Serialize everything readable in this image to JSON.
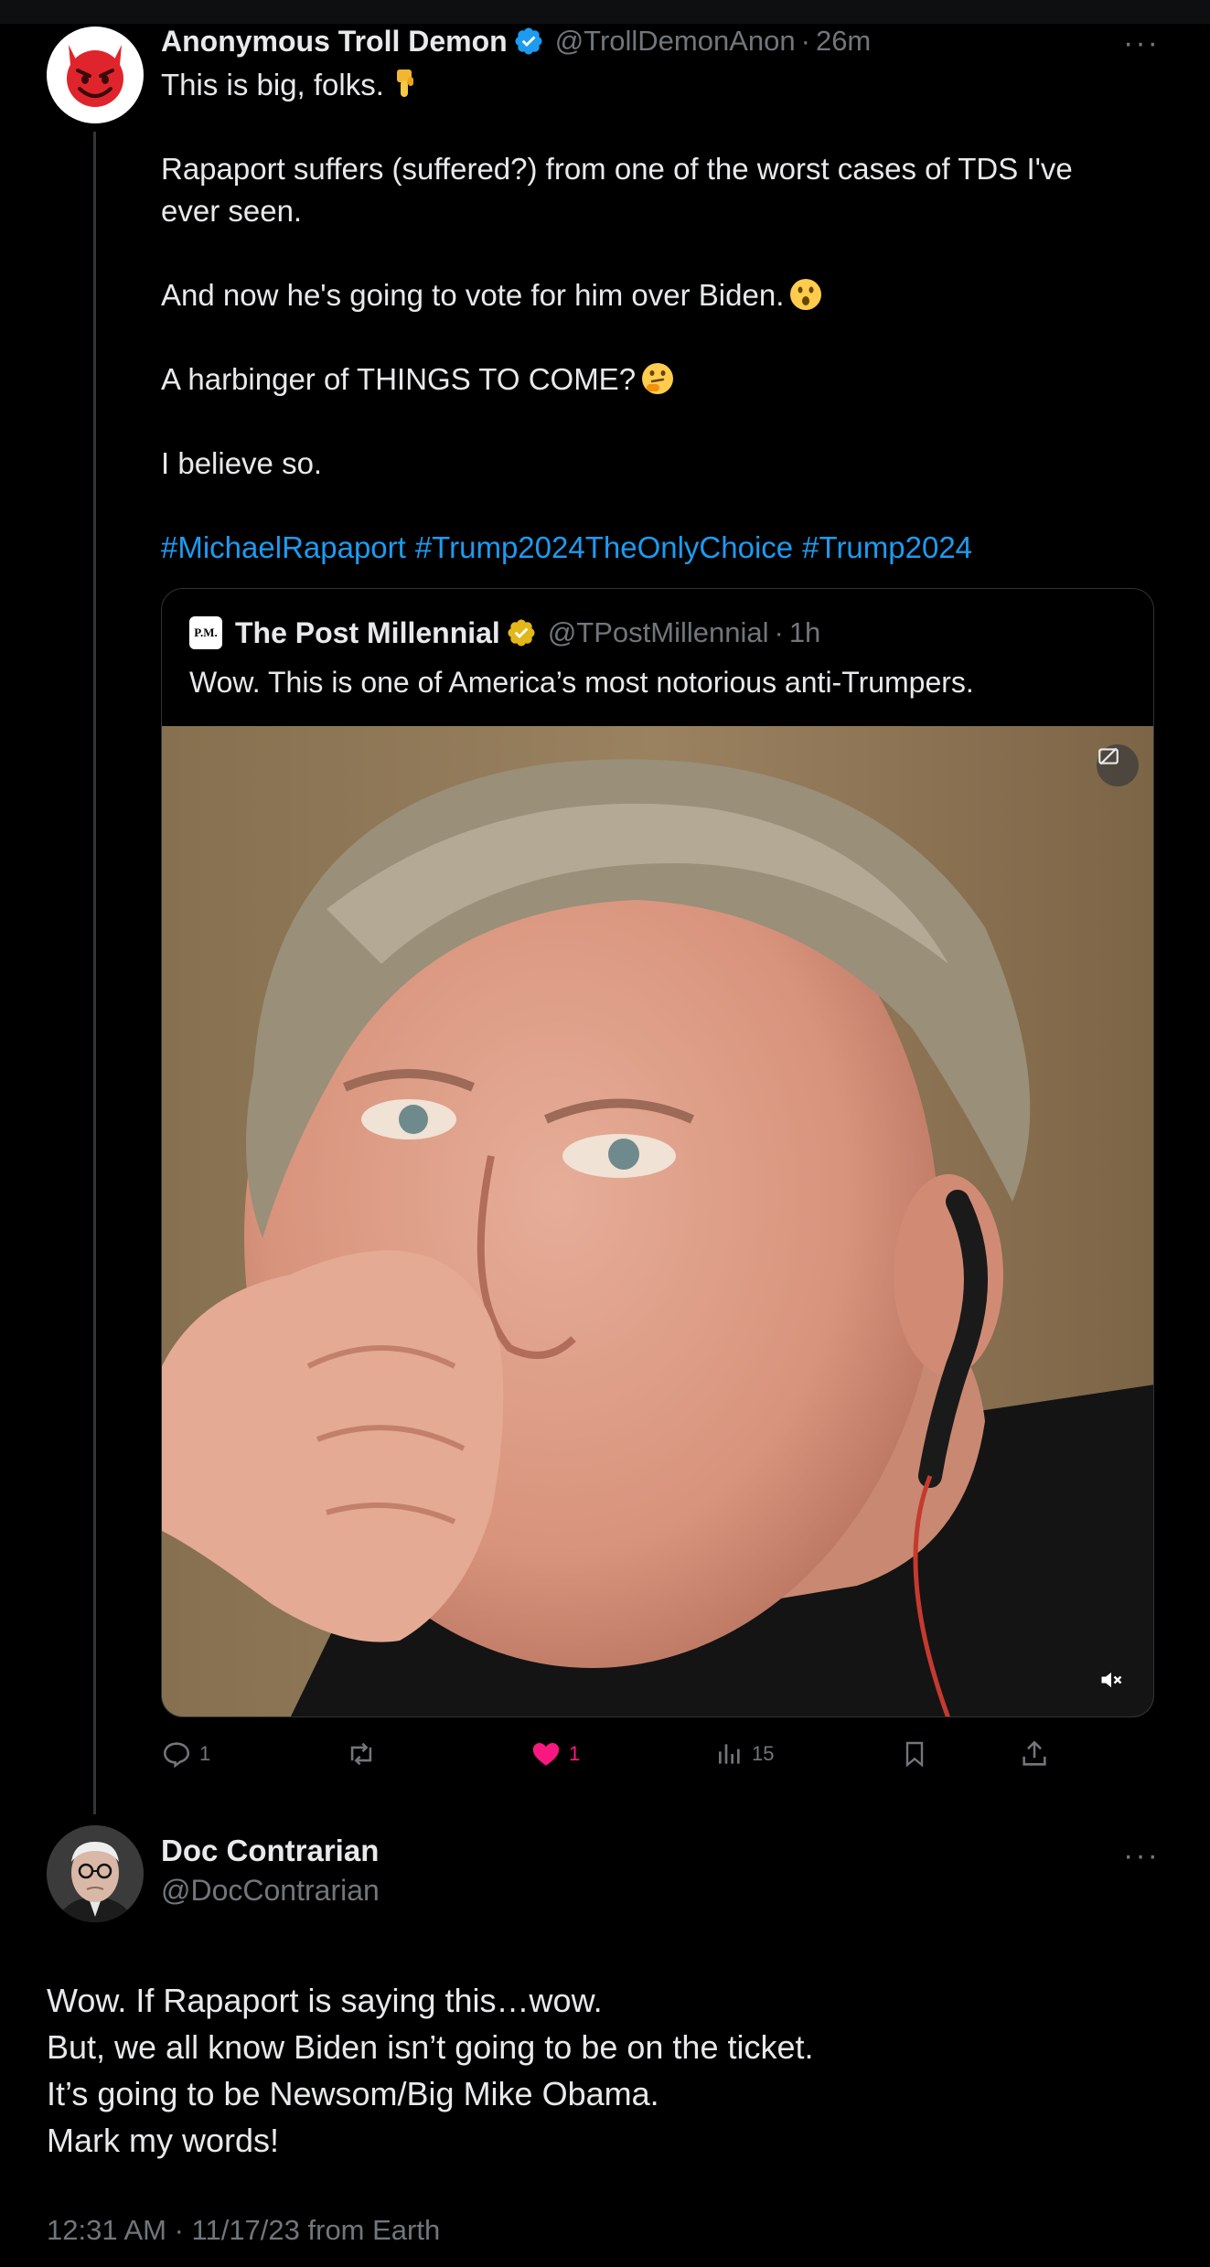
{
  "tweet": {
    "author_name": "Anonymous Troll Demon",
    "author_handle": "@TrollDemonAnon",
    "separator": "·",
    "time_ago": "26m",
    "more_label": "···",
    "avatar_icon": "smiling-devil-icon",
    "lines": [
      {
        "text": "This is big, folks.",
        "emoji": "pointing-down-icon"
      },
      {
        "text": "Rapaport suffers (suffered?) from one of the worst cases of TDS I've ever seen.",
        "emoji": ""
      },
      {
        "text": "And now he's going to vote for him over Biden.",
        "emoji": "astonished-face-icon"
      },
      {
        "text": "A harbinger of THINGS TO COME?",
        "emoji": "thinking-face-icon"
      },
      {
        "text": "I believe so.",
        "emoji": ""
      }
    ],
    "hashtags": [
      "#MichaelRapaport",
      "#Trump2024TheOnlyChoice",
      "#Trump2024"
    ],
    "quote": {
      "logo_text": "P.M.",
      "author_name": "The Post Millennial",
      "author_handle": "@TPostMillennial",
      "separator": "·",
      "time_ago": "1h",
      "text": "Wow. This is one of America’s most notorious anti-Trumpers.",
      "media_icon": "video-thumbnail-image",
      "badge_icon": "sensitive-content-icon",
      "mute_icon": "speaker-muted-icon"
    },
    "actions": {
      "replies": "1",
      "retweets": "",
      "likes": "1",
      "views": "15",
      "liked_color": "#f91880"
    }
  },
  "reply": {
    "author_name": "Doc Contrarian",
    "author_handle": "@DocContrarian",
    "more_label": "···",
    "avatar_icon": "elderly-man-portrait",
    "lines": [
      "Wow. If Rapaport is saying this…wow.",
      "But, we all know Biden isn’t going to be on the ticket.",
      "It’s going to be Newsom/Big Mike Obama.",
      "Mark my words!"
    ],
    "timestamp": "12:31 AM · 11/17/23 from Earth"
  },
  "colors": {
    "background": "#000000",
    "text": "#e7e9ea",
    "muted": "#71767b",
    "link": "#1d9bf0",
    "verified_blue": "#1d9bf0",
    "verified_gold": "#e2b719"
  }
}
